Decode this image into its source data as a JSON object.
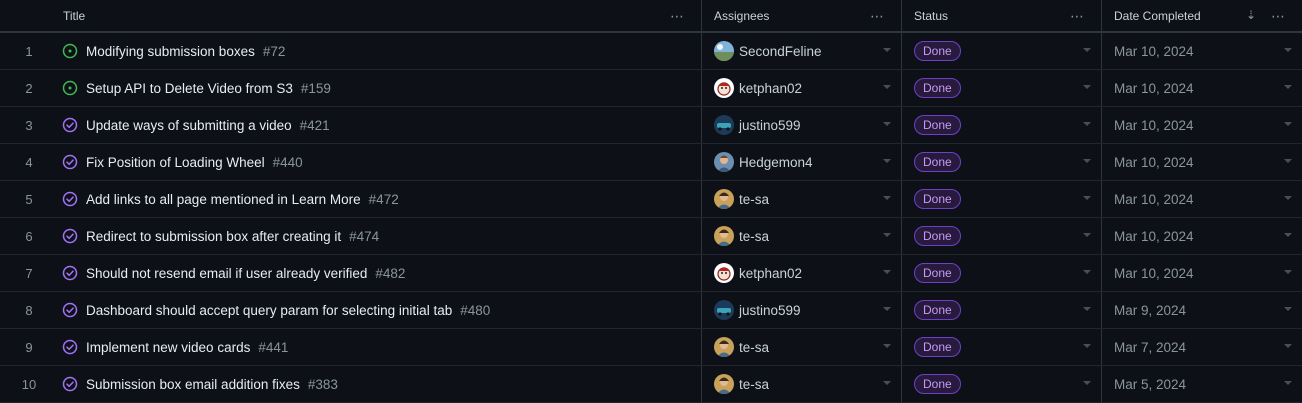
{
  "columns": {
    "title": "Title",
    "assignees": "Assignees",
    "status": "Status",
    "date_completed": "Date Completed"
  },
  "icons": {
    "more": "⋯",
    "sort": "⇣"
  },
  "colors": {
    "open_icon": "#3fb950",
    "closed_icon": "#a371f7",
    "badge_border": "#6e40c9",
    "badge_text": "#c79bf5"
  },
  "rows": [
    {
      "num": "1",
      "state": "open",
      "title": "Modifying submission boxes",
      "issue": "#72",
      "assignee": "SecondFeline",
      "avatar": "landscape",
      "status": "Done",
      "date": "Mar 10, 2024"
    },
    {
      "num": "2",
      "state": "open",
      "title": "Setup API to Delete Video from S3",
      "issue": "#159",
      "assignee": "ketphan02",
      "avatar": "cartoon",
      "status": "Done",
      "date": "Mar 10, 2024"
    },
    {
      "num": "3",
      "state": "closed",
      "title": "Update ways of submitting a video",
      "issue": "#421",
      "assignee": "justino599",
      "avatar": "car",
      "status": "Done",
      "date": "Mar 10, 2024"
    },
    {
      "num": "4",
      "state": "closed",
      "title": "Fix Position of Loading Wheel",
      "issue": "#440",
      "assignee": "Hedgemon4",
      "avatar": "person",
      "status": "Done",
      "date": "Mar 10, 2024"
    },
    {
      "num": "5",
      "state": "closed",
      "title": "Add links to all page mentioned in Learn More",
      "issue": "#472",
      "assignee": "te-sa",
      "avatar": "person2",
      "status": "Done",
      "date": "Mar 10, 2024"
    },
    {
      "num": "6",
      "state": "closed",
      "title": "Redirect to submission box after creating it",
      "issue": "#474",
      "assignee": "te-sa",
      "avatar": "person2",
      "status": "Done",
      "date": "Mar 10, 2024"
    },
    {
      "num": "7",
      "state": "closed",
      "title": "Should not resend email if user already verified",
      "issue": "#482",
      "assignee": "ketphan02",
      "avatar": "cartoon",
      "status": "Done",
      "date": "Mar 10, 2024"
    },
    {
      "num": "8",
      "state": "closed",
      "title": "Dashboard should accept query param for selecting initial tab",
      "issue": "#480",
      "assignee": "justino599",
      "avatar": "car",
      "status": "Done",
      "date": "Mar 9, 2024"
    },
    {
      "num": "9",
      "state": "closed",
      "title": "Implement new video cards",
      "issue": "#441",
      "assignee": "te-sa",
      "avatar": "person2",
      "status": "Done",
      "date": "Mar 7, 2024"
    },
    {
      "num": "10",
      "state": "closed",
      "title": "Submission box email addition fixes",
      "issue": "#383",
      "assignee": "te-sa",
      "avatar": "person2",
      "status": "Done",
      "date": "Mar 5, 2024"
    }
  ]
}
